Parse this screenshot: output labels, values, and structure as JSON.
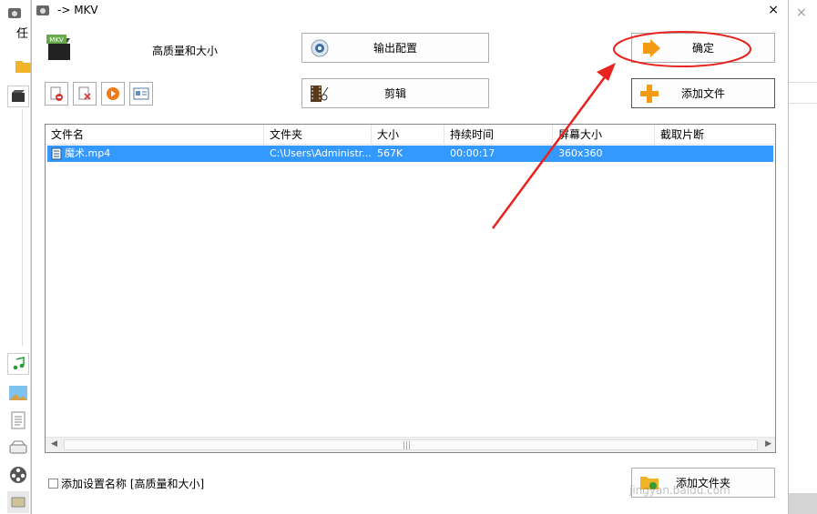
{
  "background_app": {
    "title_partial": "任",
    "icons": [
      "app-icon",
      "folder-icon",
      "film-icon",
      "music-icon",
      "picture-icon",
      "document-icon",
      "disc-icon",
      "reel-icon",
      "taskbar-icon"
    ]
  },
  "dialog": {
    "title": "-> MKV",
    "close_label": "×",
    "profile": {
      "badge": "MKV",
      "name": "高质量和大小"
    },
    "buttons": {
      "output_config": "输出配置",
      "edit": "剪辑",
      "ok": "确定",
      "add_file": "添加文件",
      "add_folder": "添加文件夹"
    },
    "table": {
      "columns": [
        "文件名",
        "文件夹",
        "大小",
        "持续时间",
        "屏幕大小",
        "截取片断"
      ],
      "rows": [
        {
          "name": "魔术.mp4",
          "folder": "C:\\Users\\Administr...",
          "size": "567K",
          "duration": "00:00:17",
          "screen": "360x360",
          "clip": ""
        }
      ]
    },
    "checkbox_label": "添加设置名称 [高质量和大小]",
    "watermark": "jingyan.baidu.com"
  },
  "colors": {
    "selection": "#3399ff",
    "annotation": "#e8231f",
    "accent_orange": "#f39c12"
  }
}
